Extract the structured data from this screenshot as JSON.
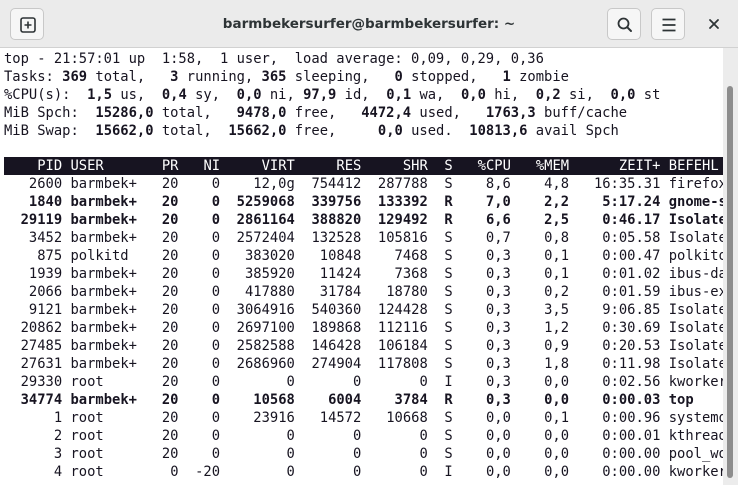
{
  "window": {
    "title": "barmbekersurfer@barmbekersurfer: ~",
    "icons": {
      "new_tab": "new-tab-icon",
      "search": "search-icon",
      "menu": "hamburger-menu-icon",
      "close": "close-icon"
    }
  },
  "summary": {
    "uptime": "top - 21:57:01 up  1:58,  1 user,  load average: 0,09, 0,29, 0,36",
    "tasks": {
      "label": "Tasks:",
      "total": "369",
      "total_label": "total,",
      "running": "3",
      "running_label": "running,",
      "sleeping": "365",
      "sleeping_label": "sleeping,",
      "stopped": "0",
      "stopped_label": "stopped,",
      "zombie": "1",
      "zombie_label": "zombie"
    },
    "cpu": {
      "label": "%CPU(s):",
      "us": "1,5",
      "us_label": "us,",
      "sy": "0,4",
      "sy_label": "sy,",
      "ni": "0,0",
      "ni_label": "ni,",
      "id": "97,9",
      "id_label": "id,",
      "wa": "0,1",
      "wa_label": "wa,",
      "hi": "0,0",
      "hi_label": "hi,",
      "si": "0,2",
      "si_label": "si,",
      "st": "0,0",
      "st_label": "st"
    },
    "mem": {
      "label": "MiB Spch:",
      "total": "15286,0",
      "total_label": "total,",
      "free": "9478,0",
      "free_label": "free,",
      "used": "4472,4",
      "used_label": "used,",
      "buff": "1763,3",
      "buff_label": "buff/cache"
    },
    "swap": {
      "label": "MiB Swap:",
      "total": "15662,0",
      "total_label": "total,",
      "free": "15662,0",
      "free_label": "free,",
      "used": "0,0",
      "used_label": "used.",
      "avail": "10813,6",
      "avail_label": "avail Spch"
    }
  },
  "table": {
    "columns": [
      "PID",
      "USER",
      "PR",
      "NI",
      "VIRT",
      "RES",
      "SHR",
      "S",
      "%CPU",
      "%MEM",
      "ZEIT+",
      "BEFEHL"
    ],
    "rows": [
      {
        "pid": "2600",
        "user": "barmbek+",
        "pr": "20",
        "ni": "0",
        "virt": "12,0g",
        "res": "754412",
        "shr": "287788",
        "s": "S",
        "cpu": "8,6",
        "mem": "4,8",
        "time": "16:35.31",
        "cmd": "firefox+",
        "bold": false
      },
      {
        "pid": "1840",
        "user": "barmbek+",
        "pr": "20",
        "ni": "0",
        "virt": "5259068",
        "res": "339756",
        "shr": "133392",
        "s": "R",
        "cpu": "7,0",
        "mem": "2,2",
        "time": "5:17.24",
        "cmd": "gnome-s+",
        "bold": true
      },
      {
        "pid": "29119",
        "user": "barmbek+",
        "pr": "20",
        "ni": "0",
        "virt": "2861164",
        "res": "388820",
        "shr": "129492",
        "s": "R",
        "cpu": "6,6",
        "mem": "2,5",
        "time": "0:46.17",
        "cmd": "Isolate+",
        "bold": true
      },
      {
        "pid": "3452",
        "user": "barmbek+",
        "pr": "20",
        "ni": "0",
        "virt": "2572404",
        "res": "132528",
        "shr": "105816",
        "s": "S",
        "cpu": "0,7",
        "mem": "0,8",
        "time": "0:05.58",
        "cmd": "Isolate+",
        "bold": false
      },
      {
        "pid": "875",
        "user": "polkitd",
        "pr": "20",
        "ni": "0",
        "virt": "383020",
        "res": "10848",
        "shr": "7468",
        "s": "S",
        "cpu": "0,3",
        "mem": "0,1",
        "time": "0:00.47",
        "cmd": "polkitd",
        "bold": false
      },
      {
        "pid": "1939",
        "user": "barmbek+",
        "pr": "20",
        "ni": "0",
        "virt": "385920",
        "res": "11424",
        "shr": "7368",
        "s": "S",
        "cpu": "0,3",
        "mem": "0,1",
        "time": "0:01.02",
        "cmd": "ibus-da+",
        "bold": false
      },
      {
        "pid": "2066",
        "user": "barmbek+",
        "pr": "20",
        "ni": "0",
        "virt": "417880",
        "res": "31784",
        "shr": "18780",
        "s": "S",
        "cpu": "0,3",
        "mem": "0,2",
        "time": "0:01.59",
        "cmd": "ibus-ex+",
        "bold": false
      },
      {
        "pid": "9121",
        "user": "barmbek+",
        "pr": "20",
        "ni": "0",
        "virt": "3064916",
        "res": "540360",
        "shr": "124428",
        "s": "S",
        "cpu": "0,3",
        "mem": "3,5",
        "time": "9:06.85",
        "cmd": "Isolate+",
        "bold": false
      },
      {
        "pid": "20862",
        "user": "barmbek+",
        "pr": "20",
        "ni": "0",
        "virt": "2697100",
        "res": "189868",
        "shr": "112116",
        "s": "S",
        "cpu": "0,3",
        "mem": "1,2",
        "time": "0:30.69",
        "cmd": "Isolate+",
        "bold": false
      },
      {
        "pid": "27485",
        "user": "barmbek+",
        "pr": "20",
        "ni": "0",
        "virt": "2582588",
        "res": "146428",
        "shr": "106184",
        "s": "S",
        "cpu": "0,3",
        "mem": "0,9",
        "time": "0:20.53",
        "cmd": "Isolate+",
        "bold": false
      },
      {
        "pid": "27631",
        "user": "barmbek+",
        "pr": "20",
        "ni": "0",
        "virt": "2686960",
        "res": "274904",
        "shr": "117808",
        "s": "S",
        "cpu": "0,3",
        "mem": "1,8",
        "time": "0:11.98",
        "cmd": "Isolate+",
        "bold": false
      },
      {
        "pid": "29330",
        "user": "root",
        "pr": "20",
        "ni": "0",
        "virt": "0",
        "res": "0",
        "shr": "0",
        "s": "I",
        "cpu": "0,3",
        "mem": "0,0",
        "time": "0:02.56",
        "cmd": "kworker+",
        "bold": false
      },
      {
        "pid": "34774",
        "user": "barmbek+",
        "pr": "20",
        "ni": "0",
        "virt": "10568",
        "res": "6004",
        "shr": "3784",
        "s": "R",
        "cpu": "0,3",
        "mem": "0,0",
        "time": "0:00.03",
        "cmd": "top",
        "bold": true
      },
      {
        "pid": "1",
        "user": "root",
        "pr": "20",
        "ni": "0",
        "virt": "23916",
        "res": "14572",
        "shr": "10668",
        "s": "S",
        "cpu": "0,0",
        "mem": "0,1",
        "time": "0:00.96",
        "cmd": "systemd",
        "bold": false
      },
      {
        "pid": "2",
        "user": "root",
        "pr": "20",
        "ni": "0",
        "virt": "0",
        "res": "0",
        "shr": "0",
        "s": "S",
        "cpu": "0,0",
        "mem": "0,0",
        "time": "0:00.01",
        "cmd": "kthreadd",
        "bold": false
      },
      {
        "pid": "3",
        "user": "root",
        "pr": "20",
        "ni": "0",
        "virt": "0",
        "res": "0",
        "shr": "0",
        "s": "S",
        "cpu": "0,0",
        "mem": "0,0",
        "time": "0:00.00",
        "cmd": "pool_wo+",
        "bold": false
      },
      {
        "pid": "4",
        "user": "root",
        "pr": "0",
        "ni": "-20",
        "virt": "0",
        "res": "0",
        "shr": "0",
        "s": "I",
        "cpu": "0,0",
        "mem": "0,0",
        "time": "0:00.00",
        "cmd": "kworker+",
        "bold": false
      }
    ]
  }
}
